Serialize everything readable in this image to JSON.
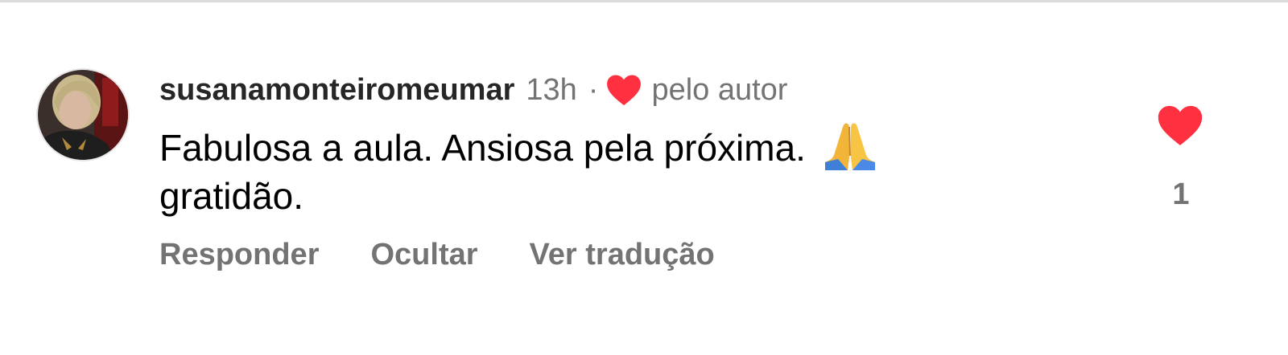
{
  "comment": {
    "username": "susanamonteiromeumar",
    "timestamp": "13h",
    "separator": "·",
    "liked_by_author_label": "pelo autor",
    "text_line1": "Fabulosa a aula. Ansiosa pela próxima.",
    "text_line2": "gratidão.",
    "like_count": "1"
  },
  "actions": {
    "reply_label": "Responder",
    "hide_label": "Ocultar",
    "translate_label": "Ver tradução"
  },
  "icons": {
    "author_like": "heart-icon",
    "comment_like": "heart-icon",
    "emoji": "folded-hands-emoji"
  },
  "colors": {
    "heart": "#ff3040",
    "username": "#262626",
    "secondary_text": "#737373",
    "text": "#000000"
  }
}
